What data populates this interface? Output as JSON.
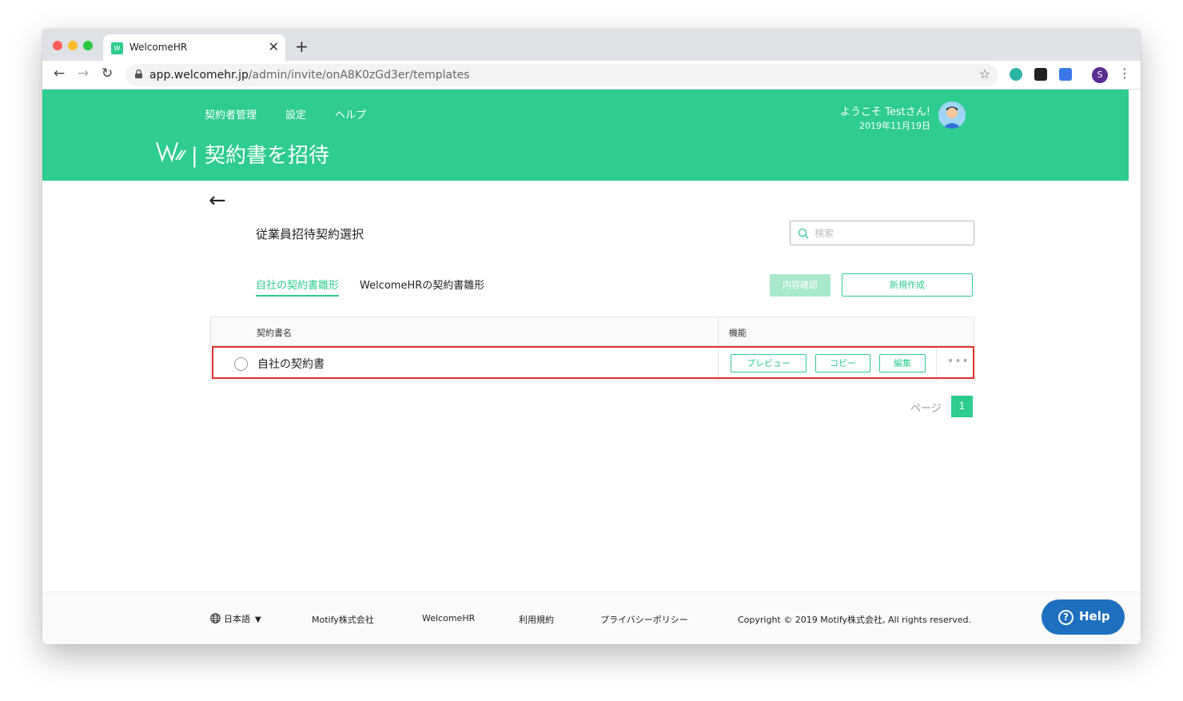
{
  "browser": {
    "tab_title": "WelcomeHR",
    "tab_close": "✕",
    "new_tab": "+",
    "url_host": "app.welcomehr.jp",
    "url_path": "/admin/invite/onA8K0zGd3er/templates",
    "profile_initial": "S",
    "back": "←",
    "forward": "→",
    "reload": "↻",
    "star": "☆",
    "menu": "⋮"
  },
  "header": {
    "nav": [
      "契約者管理",
      "設定",
      "ヘルプ"
    ],
    "welcome": "ようこそ Testさん!",
    "date": "2019年11月19日",
    "page_title": "| 契約書を招待",
    "color": "#2ecc8f"
  },
  "main": {
    "back_arrow": "←",
    "section_title": "従業員招待契約選択",
    "search_placeholder": "検索",
    "tabs": [
      "自社の契約書雛形",
      "WelcomeHRの契約書雛形"
    ],
    "confirm_button": "内容確認",
    "new_button": "新規作成",
    "table": {
      "headers": [
        "契約書名",
        "機能"
      ],
      "rows": [
        {
          "name": "自社の契約書",
          "actions": [
            "プレビュー",
            "コピー",
            "編集"
          ],
          "more": "•••"
        }
      ]
    },
    "pagination": {
      "label": "ページ",
      "current": "1"
    }
  },
  "footer": {
    "language": "日本語",
    "links": [
      "Motify株式会社",
      "WelcomeHR",
      "利用規約",
      "プライバシーポリシー"
    ],
    "copyright": "Copyright © 2019 Motify株式会社, All rights reserved."
  },
  "help": {
    "label": "Help",
    "icon_glyph": "?",
    "color": "#1e6fbf"
  },
  "highlight_color": "#e0302b"
}
